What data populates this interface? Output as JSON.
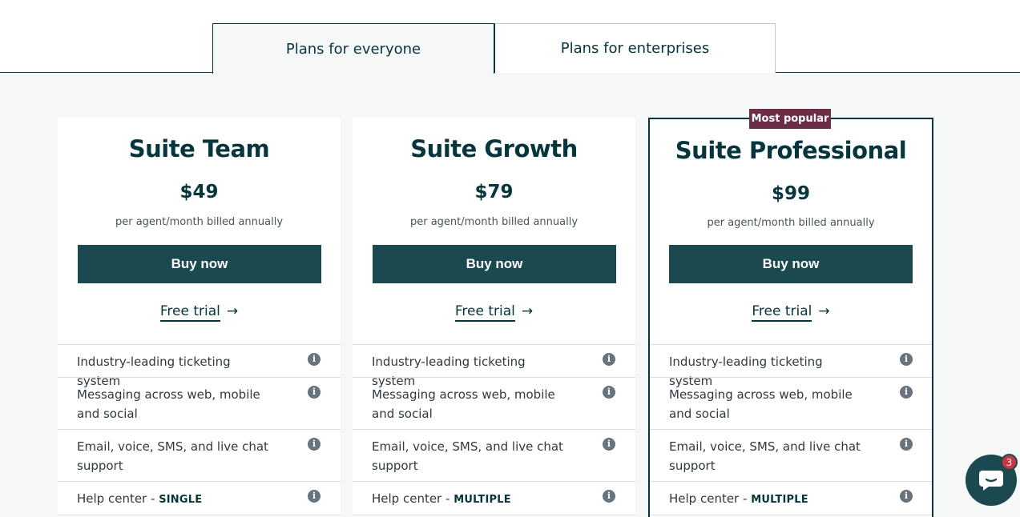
{
  "tabs": [
    {
      "label": "Plans for everyone",
      "active": true
    },
    {
      "label": "Plans for enterprises",
      "active": false
    }
  ],
  "badge": "Most popular",
  "plans": [
    {
      "name": "Suite Team",
      "price": "$49",
      "billing": "per agent/month billed annually",
      "buy_label": "Buy now",
      "trial_label": "Free trial",
      "features": {
        "ticketing": "Industry-leading ticketing system",
        "messaging": "Messaging across web, mobile and social",
        "email": "Email, voice, SMS, and live chat support",
        "help_center_prefix": "Help center - ",
        "help_center_value": "SINGLE"
      }
    },
    {
      "name": "Suite Growth",
      "price": "$79",
      "billing": "per agent/month billed annually",
      "buy_label": "Buy now",
      "trial_label": "Free trial",
      "features": {
        "ticketing": "Industry-leading ticketing system",
        "messaging": "Messaging across web, mobile and social",
        "email": "Email, voice, SMS, and live chat support",
        "help_center_prefix": "Help center - ",
        "help_center_value": "MULTIPLE"
      }
    },
    {
      "name": "Suite Professional",
      "price": "$99",
      "billing": "per agent/month billed annually",
      "buy_label": "Buy now",
      "trial_label": "Free trial",
      "features": {
        "ticketing": "Industry-leading ticketing system",
        "messaging": "Messaging across web, mobile and social",
        "email": "Email, voice, SMS, and live chat support",
        "help_center_prefix": "Help center - ",
        "help_center_value": "MULTIPLE"
      }
    }
  ],
  "chat": {
    "unread_count": "3"
  },
  "colors": {
    "brand": "#03363d",
    "button": "#1a4a4f",
    "badge": "#6e2d47",
    "notification": "#cc3340"
  }
}
